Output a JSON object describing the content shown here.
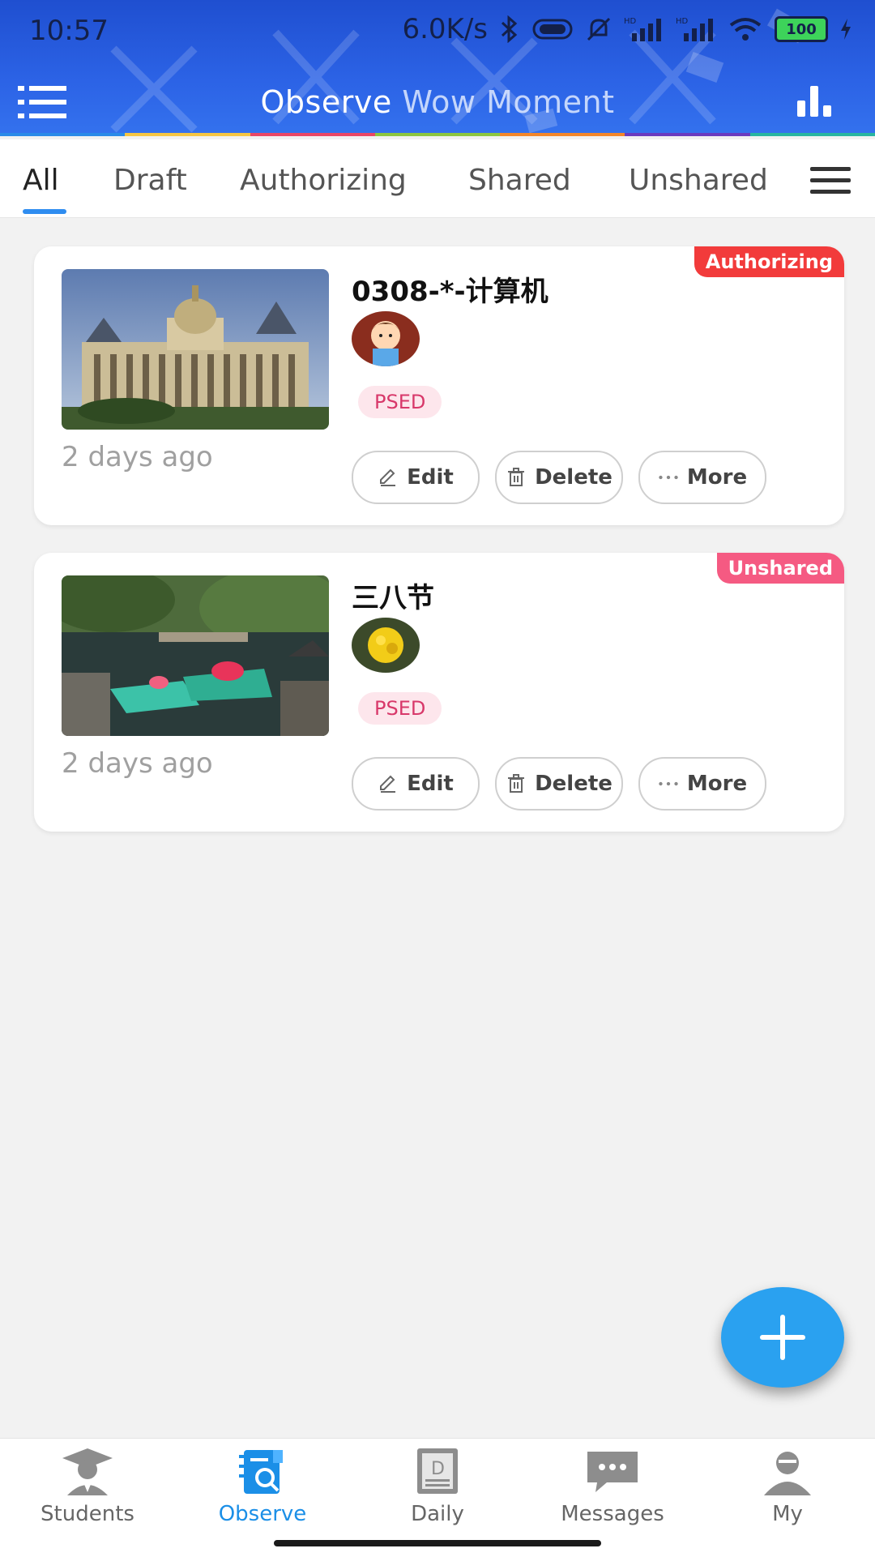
{
  "status_bar": {
    "time": "10:57",
    "net_speed": "6.0K/s",
    "battery": "100"
  },
  "app_bar": {
    "title_primary": "Observe",
    "title_secondary": "Wow Moment"
  },
  "tabs": [
    {
      "label": "All",
      "active": true
    },
    {
      "label": "Draft",
      "active": false
    },
    {
      "label": "Authorizing",
      "active": false
    },
    {
      "label": "Shared",
      "active": false
    },
    {
      "label": "Unshared",
      "active": false
    }
  ],
  "cards": [
    {
      "title": "0308-*-计算机",
      "tag": "PSED",
      "status": "Authorizing",
      "status_color": "#f23b3b",
      "age": "2 days ago",
      "edit_label": "Edit",
      "delete_label": "Delete",
      "more_label": "More"
    },
    {
      "title": "三八节",
      "tag": "PSED",
      "status": "Unshared",
      "status_color": "#f55a82",
      "age": "2 days ago",
      "edit_label": "Edit",
      "delete_label": "Delete",
      "more_label": "More"
    }
  ],
  "bottom_nav": [
    {
      "label": "Students",
      "icon": "graduate-icon",
      "active": false
    },
    {
      "label": "Observe",
      "icon": "observe-notebook-icon",
      "active": true
    },
    {
      "label": "Daily",
      "icon": "daily-doc-icon",
      "active": false
    },
    {
      "label": "Messages",
      "icon": "chat-bubble-icon",
      "active": false
    },
    {
      "label": "My",
      "icon": "user-icon",
      "active": false
    }
  ],
  "colors": {
    "accent": "#2f8df0",
    "fab": "#2aa1f0",
    "chip_text": "#d8386a",
    "chip_bg": "#fde6ec"
  }
}
